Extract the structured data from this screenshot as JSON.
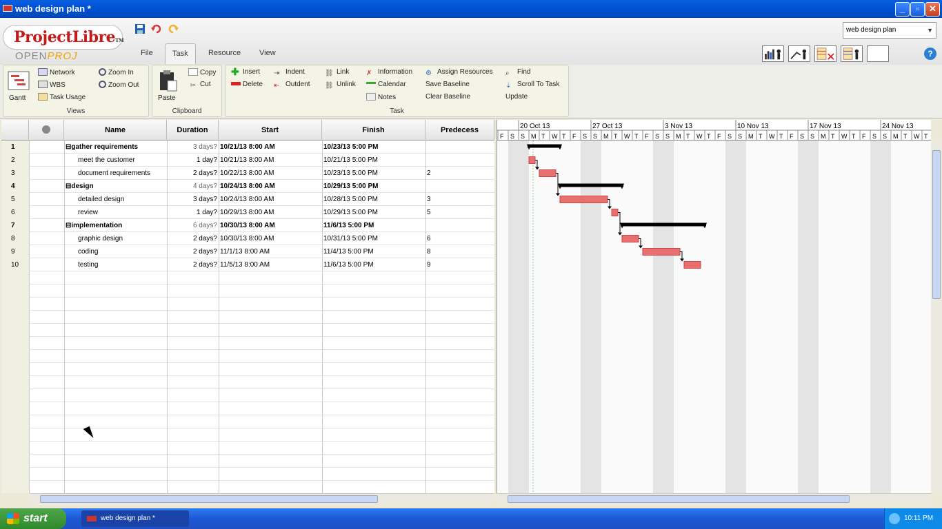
{
  "window": {
    "title": "web design plan *"
  },
  "logo": {
    "brand": "ProjectLibre",
    "tm": "TM",
    "sub_open": "OPEN",
    "sub_proj": "PROJ"
  },
  "tabs": [
    "File",
    "Task",
    "Resource",
    "View"
  ],
  "active_tab": "Task",
  "project_select": {
    "value": "web design plan"
  },
  "ribbon": {
    "views": {
      "label": "Views",
      "gantt": "Gantt",
      "network": "Network",
      "wbs": "WBS",
      "task_usage": "Task Usage",
      "zoom_in": "Zoom In",
      "zoom_out": "Zoom Out"
    },
    "clipboard": {
      "label": "Clipboard",
      "paste": "Paste",
      "copy": "Copy",
      "cut": "Cut"
    },
    "task": {
      "label": "Task",
      "insert": "Insert",
      "delete": "Delete",
      "indent": "Indent",
      "outdent": "Outdent",
      "link": "Link",
      "unlink": "Unlink",
      "information": "Information",
      "calendar": "Calendar",
      "notes": "Notes",
      "assign_resources": "Assign Resources",
      "save_baseline": "Save Baseline",
      "clear_baseline": "Clear Baseline",
      "find": "Find",
      "scroll_to_task": "Scroll To Task",
      "update": "Update"
    }
  },
  "grid": {
    "columns": [
      "",
      "",
      "Name",
      "Duration",
      "Start",
      "Finish",
      "Predecess"
    ],
    "rows": [
      {
        "id": "1",
        "name": "gather requirements",
        "duration": "3 days?",
        "start": "10/21/13 8:00 AM",
        "finish": "10/23/13 5:00 PM",
        "pred": "",
        "summary": true
      },
      {
        "id": "2",
        "name": "meet the customer",
        "duration": "1 day?",
        "start": "10/21/13 8:00 AM",
        "finish": "10/21/13 5:00 PM",
        "pred": "",
        "summary": false
      },
      {
        "id": "3",
        "name": "document requirements",
        "duration": "2 days?",
        "start": "10/22/13 8:00 AM",
        "finish": "10/23/13 5:00 PM",
        "pred": "2",
        "summary": false
      },
      {
        "id": "4",
        "name": "design",
        "duration": "4 days?",
        "start": "10/24/13 8:00 AM",
        "finish": "10/29/13 5:00 PM",
        "pred": "",
        "summary": true
      },
      {
        "id": "5",
        "name": "detailed design",
        "duration": "3 days?",
        "start": "10/24/13 8:00 AM",
        "finish": "10/28/13 5:00 PM",
        "pred": "3",
        "summary": false
      },
      {
        "id": "6",
        "name": "review",
        "duration": "1 day?",
        "start": "10/29/13 8:00 AM",
        "finish": "10/29/13 5:00 PM",
        "pred": "5",
        "summary": false
      },
      {
        "id": "7",
        "name": "implementation",
        "duration": "6 days?",
        "start": "10/30/13 8:00 AM",
        "finish": "11/6/13 5:00 PM",
        "pred": "",
        "summary": true
      },
      {
        "id": "8",
        "name": "graphic design",
        "duration": "2 days?",
        "start": "10/30/13 8:00 AM",
        "finish": "10/31/13 5:00 PM",
        "pred": "6",
        "summary": false
      },
      {
        "id": "9",
        "name": "coding",
        "duration": "2 days?",
        "start": "11/1/13 8:00 AM",
        "finish": "11/4/13 5:00 PM",
        "pred": "8",
        "summary": false
      },
      {
        "id": "10",
        "name": "testing",
        "duration": "2 days?",
        "start": "11/5/13 8:00 AM",
        "finish": "11/6/13 5:00 PM",
        "pred": "9",
        "summary": false
      }
    ]
  },
  "gantt": {
    "weeks": [
      "20 Oct 13",
      "27 Oct 13",
      "3 Nov 13",
      "10 Nov 13",
      "17 Nov 13",
      "24 Nov 13"
    ],
    "day_letters": [
      "S",
      "M",
      "T",
      "W",
      "T",
      "F",
      "S"
    ],
    "first_day_letters": [
      "F",
      "S"
    ],
    "bar_color": "#e87070",
    "summary_color": "#000000"
  },
  "taskbar": {
    "start": "start",
    "task": "web design plan *",
    "clock": "10:11 PM"
  }
}
